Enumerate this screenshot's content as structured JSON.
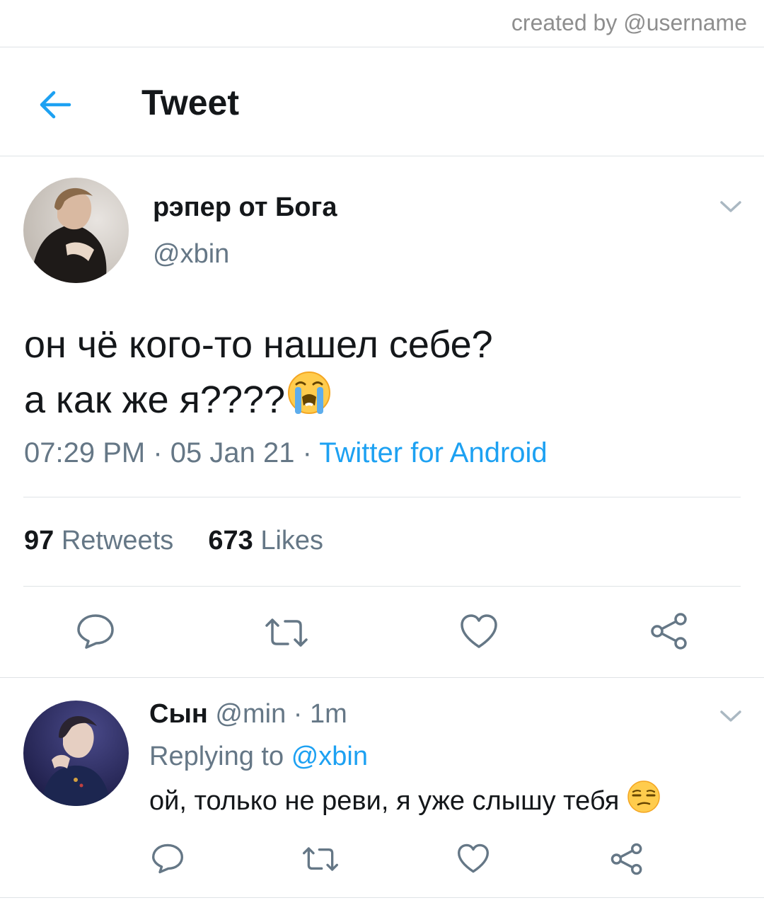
{
  "watermark": "created by @username",
  "header": {
    "title": "Tweet"
  },
  "tweet": {
    "author_name": "рэпер от Бога",
    "author_handle": "@xbin",
    "text_line1": "он чё кого-то нашел себе?",
    "text_line2": "а как же я????",
    "emoji": "loudly-crying-face",
    "time": "07:29 PM",
    "date": "05 Jan 21",
    "separator": " · ",
    "source": "Twitter for Android",
    "retweets_count": "97",
    "retweets_label": "Retweets",
    "likes_count": "673",
    "likes_label": "Likes"
  },
  "reply": {
    "author_name": "Сын",
    "author_handle": "@min",
    "time_sep": " · ",
    "time": "1m",
    "replying_label": "Replying to",
    "replying_to": "@xbin",
    "text": "ой, только не реви, я уже слышу тебя",
    "emoji": "unamused-face"
  },
  "icons": [
    "back-arrow-icon",
    "chevron-down-icon",
    "reply-icon",
    "retweet-icon",
    "like-icon",
    "share-icon"
  ],
  "colors": {
    "accent": "#1da1f2",
    "secondary_text": "#657786",
    "divider": "#dfe3e6"
  }
}
